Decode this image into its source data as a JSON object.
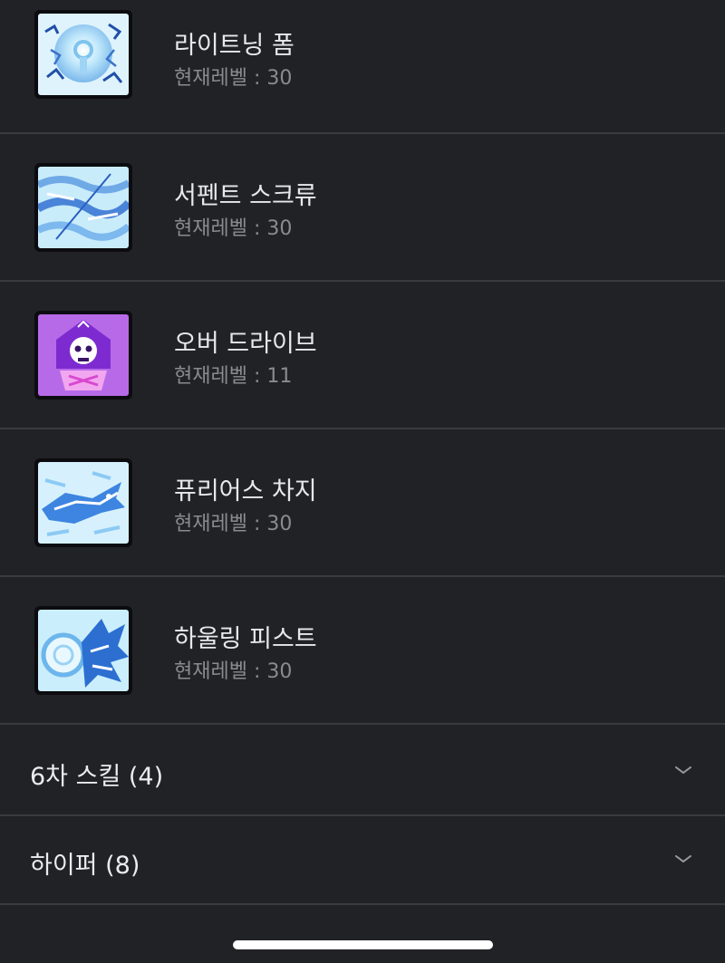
{
  "skills": [
    {
      "name": "라이트닝 폼",
      "level": "현재레벨 : 30",
      "icon": "lightning-form-icon"
    },
    {
      "name": "서펜트 스크류",
      "level": "현재레벨 : 30",
      "icon": "serpent-screw-icon"
    },
    {
      "name": "오버 드라이브",
      "level": "현재레벨 : 11",
      "icon": "overdrive-icon"
    },
    {
      "name": "퓨리어스 차지",
      "level": "현재레벨 : 30",
      "icon": "furious-charge-icon"
    },
    {
      "name": "하울링 피스트",
      "level": "현재레벨 : 30",
      "icon": "howling-fist-icon"
    }
  ],
  "sections": [
    {
      "title": "6차 스킬 (4)",
      "icon": "chevron-down-icon"
    },
    {
      "title": "하이퍼 (8)",
      "icon": "chevron-down-icon"
    }
  ],
  "colors": {
    "background": "#212226",
    "divider": "#3a3b41",
    "name_text": "#e8e8ea",
    "level_text": "#8a8b90"
  }
}
